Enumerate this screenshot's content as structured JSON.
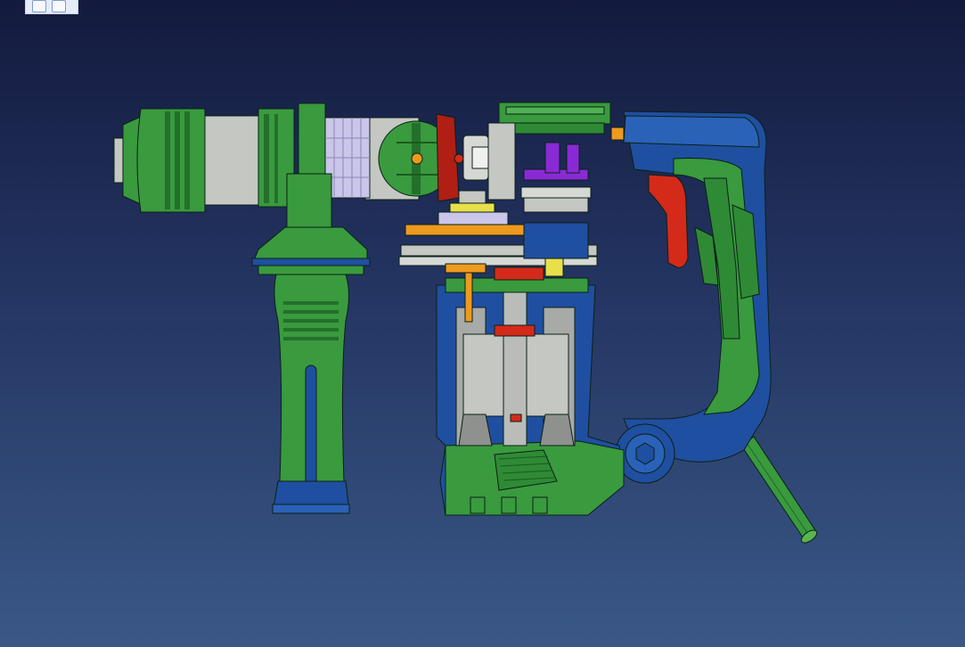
{
  "viewer": {
    "background_top": "#131a3e",
    "background_bottom": "#3a5886",
    "toolbar_badge_label": ""
  },
  "model": {
    "colors": {
      "body_green": "#3a9a3e",
      "dark_green": "#23702a",
      "housing_blue": "#1f4fa0",
      "steel_gray": "#c4c7c2",
      "trigger_red": "#d42a1a",
      "gear_orange": "#ee9a1e",
      "purple_part": "#8a2ad6",
      "yellow_part": "#e8e04a",
      "spring_lavender": "#c9c6ea"
    },
    "parts": [
      "chuck",
      "barrel",
      "spring-stack",
      "mode-selector-knob",
      "side-handle",
      "gear-assembly",
      "motor-armature",
      "motor-housing",
      "main-handle",
      "trigger",
      "power-cord"
    ]
  }
}
